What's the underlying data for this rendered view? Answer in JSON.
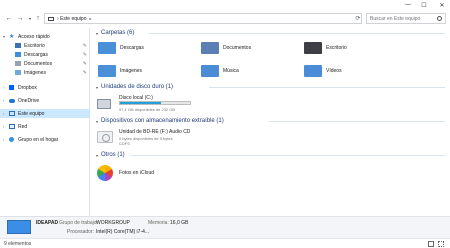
{
  "titlebar": {
    "minimize_glyph": "—",
    "maximize_glyph": "☐",
    "close_glyph": "✕"
  },
  "address": {
    "crumb": "Este equipo",
    "search_placeholder": "Buscar en Este equipo"
  },
  "sidebar": {
    "items": [
      {
        "label": "Acceso rápido",
        "icon": "star-icon",
        "pinned": false
      },
      {
        "label": "Escritorio",
        "icon": "desktop-folder-icon",
        "pinned": true
      },
      {
        "label": "Descargas",
        "icon": "download-folder-icon",
        "pinned": true
      },
      {
        "label": "Documentos",
        "icon": "documents-folder-icon",
        "pinned": true
      },
      {
        "label": "Imágenes",
        "icon": "pictures-folder-icon",
        "pinned": true
      },
      {
        "label": "Dropbox",
        "icon": "dropbox-icon",
        "pinned": false
      },
      {
        "label": "OneDrive",
        "icon": "onedrive-icon",
        "pinned": false
      },
      {
        "label": "Este equipo",
        "icon": "pc-icon",
        "pinned": false
      },
      {
        "label": "Red",
        "icon": "network-icon",
        "pinned": false
      },
      {
        "label": "Grupo en el hogar",
        "icon": "homegroup-icon",
        "pinned": false
      }
    ]
  },
  "sections": {
    "folders": "Carpetas (6)",
    "drives": "Unidades de disco duro (1)",
    "removable": "Dispositivos con almacenamiento extraíble (1)",
    "others": "Otros (1)"
  },
  "folders": [
    {
      "label": "Descargas",
      "color": "#4a90d9"
    },
    {
      "label": "Documentos",
      "color": "#5b7fb5"
    },
    {
      "label": "Escritorio",
      "color": "#3d3f45"
    },
    {
      "label": "Imágenes",
      "color": "#4a90d9"
    },
    {
      "label": "Música",
      "color": "#4a8dd6"
    },
    {
      "label": "Vídeos",
      "color": "#4a8dd6"
    }
  ],
  "drive": {
    "name": "Disco local (C:)",
    "info": "97,1 GB disponibles de 232 GB",
    "used_fraction": 0.58,
    "bar_color": "#26a0da"
  },
  "cd": {
    "name": "Unidad de BD-RE (F:) Audio CD",
    "info": "0 bytes disponibles de 0 bytes",
    "fs": "CDFS"
  },
  "others": {
    "photos_label": "Fotos en iCloud"
  },
  "details": {
    "device": "IDEAPAD",
    "workgroup_key": "Grupo de trabajo:",
    "workgroup_val": "WORKGROUP",
    "memory_key": "Memoria:",
    "memory_val": "16,0 GB",
    "cpu_key": "Procesador:",
    "cpu_val": "Intel(R) Core(TM) i7-4..."
  },
  "status": {
    "count": "9 elementos"
  },
  "colors": {
    "accent": "#26a0da",
    "selection": "#cce8ff",
    "section_header": "#1e3d7a"
  }
}
